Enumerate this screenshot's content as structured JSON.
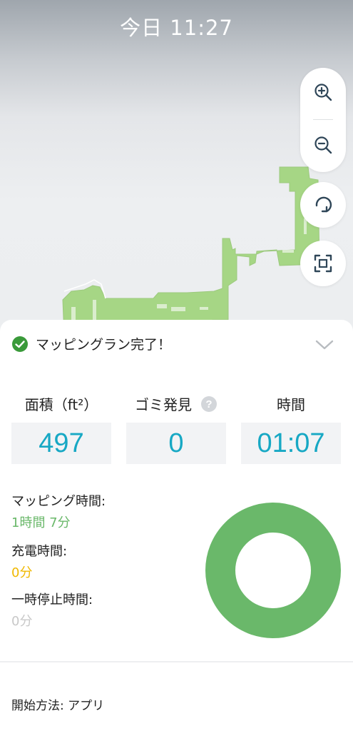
{
  "header": {
    "title": "今日 11:27"
  },
  "map": {
    "floor_color": "#a6d685",
    "controls": {
      "zoom_in": "zoom-in-icon",
      "zoom_out": "zoom-out-icon",
      "rotate": "rotate-icon",
      "fit": "fit-screen-icon"
    }
  },
  "panel": {
    "status": {
      "text": "マッピングラン完了！",
      "icon": "check-circle-icon",
      "color": "#3a9a3a"
    },
    "stats": {
      "area_label": "面積（ft²）",
      "area_value": "497",
      "debris_label": "ゴミ発見",
      "debris_value": "0",
      "time_label": "時間",
      "time_value": "01:07",
      "value_color": "#17a8c4"
    },
    "times": {
      "mapping_label": "マッピング時間:",
      "mapping_value": "1時間 7分",
      "mapping_color": "#6ab86a",
      "charging_label": "充電時間:",
      "charging_value": "0分",
      "charging_color": "#f0b800",
      "paused_label": "一時停止時間:",
      "paused_value": "0分",
      "paused_color": "#c8c8c8"
    },
    "donut": {
      "mapping_fraction": 1.0,
      "color": "#6ab86a"
    },
    "start_method": "開始方法: アプリ"
  }
}
